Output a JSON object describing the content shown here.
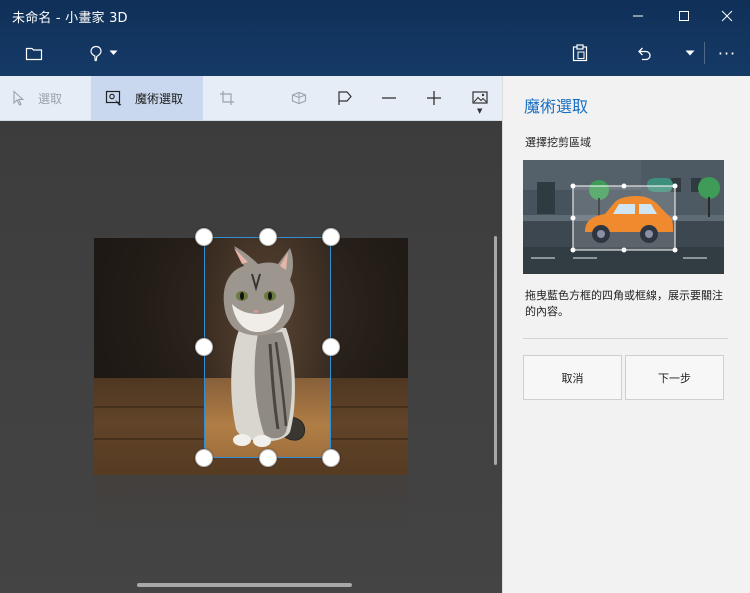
{
  "window": {
    "title": "未命名 - 小畫家 3D"
  },
  "commandbar": {
    "more_label": "···"
  },
  "toolbar": {
    "select_label": "選取",
    "magic_select_label": "魔術選取"
  },
  "panel": {
    "title": "魔術選取",
    "subtitle": "選擇挖剪區域",
    "description": "拖曳藍色方框的四角或框線，展示要關注的內容。",
    "cancel_label": "取消",
    "next_label": "下一步"
  },
  "colors": {
    "accent": "#1a6fc2",
    "selection_border": "#2e8fd4",
    "titlebar": "#12355f",
    "toolbar": "#e6edf6",
    "active_tool": "#c9d8ef",
    "canvas": "#404040",
    "panel": "#f2f2f2"
  },
  "icons": [
    "folder-icon",
    "brush-icon",
    "paste-icon",
    "undo-icon",
    "history-icon",
    "select-icon",
    "magic-select-icon",
    "crop-icon",
    "3d-view-icon",
    "flag-icon",
    "zoom-out-icon",
    "zoom-in-icon",
    "image-icon"
  ]
}
